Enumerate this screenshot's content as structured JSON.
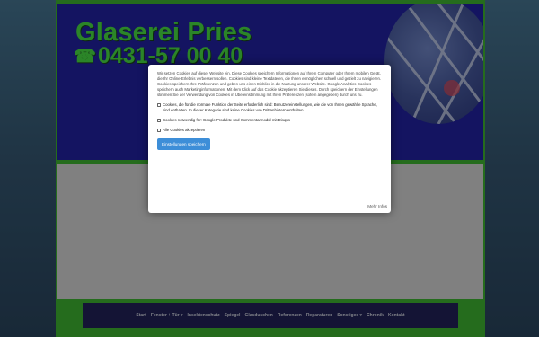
{
  "header": {
    "logo_text": "Glaserei Pries",
    "phone": "0431-57 00 40",
    "phone_icon": "telephone-icon"
  },
  "nav": {
    "items": [
      {
        "label": "Start"
      },
      {
        "label": "Fenster + Tür ▾"
      },
      {
        "label": "Insektenschutz"
      },
      {
        "label": "Spiegel"
      },
      {
        "label": "Glasduschen"
      },
      {
        "label": "Referenzen"
      },
      {
        "label": "Reparaturen"
      },
      {
        "label": "Sonstiges ▾"
      },
      {
        "label": "Chronik"
      },
      {
        "label": "Kontakt"
      }
    ]
  },
  "cookie_modal": {
    "text": "Wir setzen Cookies auf dieser Website ein. Diese Cookies speichern Informationen auf Ihrem Computer oder Ihrem mobilen Gerät, die Ihr Online-Erlebnis verbessern sollen. Cookies sind kleine Textdateien, die Ihnen ermöglichen schnell und gezielt zu navigieren. Cookies speichern Ihre Präferenzen und geben uns einen Einblick in die Nutzung unserer Website. Google Analytics-Cookies speichern auch Marketinginformationen. Mit dem Klick auf das Cookie akzeptieren Sie dieses. Durch speichern der Einstellungen stimmen Sie der Verwendung von Cookies in Übereinstimmung mit Ihren Präferenzen (sofern angegeben) durch uns zu.",
    "options": [
      {
        "label": "Cookies, die für die normale Funktion der Seite erforderlich sind: Benutzereinstellungen, wie die von Ihnen gewählte Sprache, sind enthalten. In dieser Kategorie sind keine Cookies von Drittanbietern enthalten.",
        "checked": false
      },
      {
        "label": "Cookies notwendig für: Google Produkte und Kommentarmodul mit Disqus",
        "checked": false
      },
      {
        "label": "Alle Cookies akzeptieren",
        "checked": false
      }
    ],
    "save_label": "Einstellungen speichern",
    "more_info_label": "Mehr Infos"
  },
  "colors": {
    "header_bg": "#1414a0",
    "brand_green": "#3fe23a",
    "frame_green": "#33b526",
    "nav_bg": "#141450",
    "button_blue": "#3d8ed8"
  }
}
